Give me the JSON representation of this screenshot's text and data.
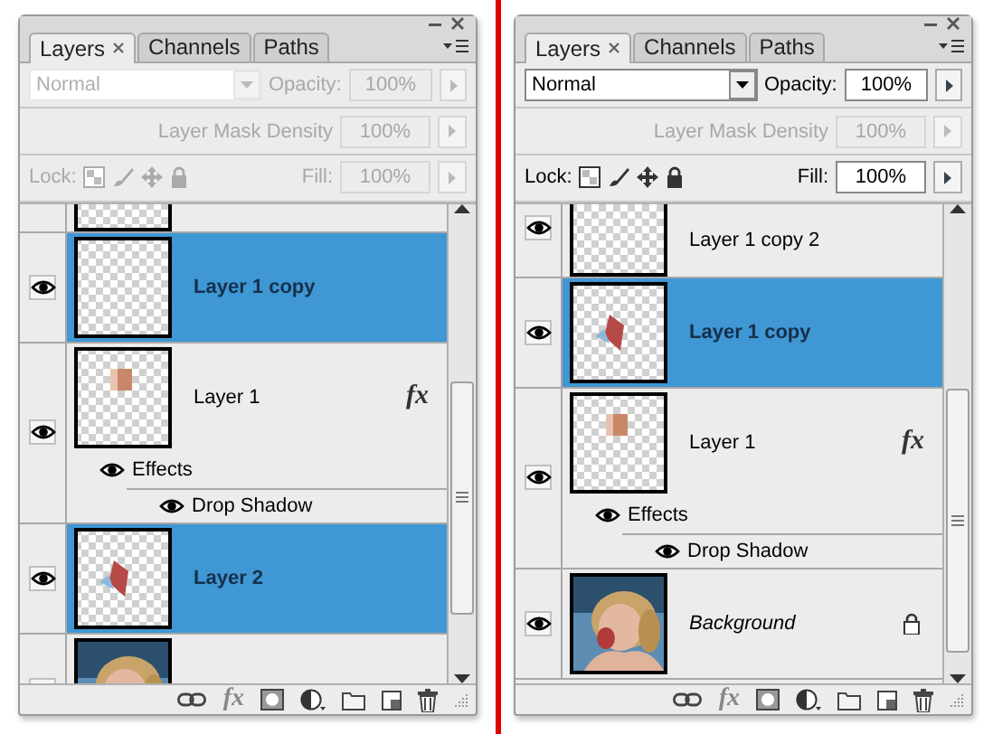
{
  "panels": [
    {
      "tabs": [
        {
          "label": "Layers",
          "selected": true
        },
        {
          "label": "Channels",
          "selected": false
        },
        {
          "label": "Paths",
          "selected": false
        }
      ],
      "blend_mode": {
        "value": "Normal",
        "disabled": true
      },
      "opacity": {
        "label": "Opacity:",
        "value": "100%",
        "disabled": true
      },
      "mask_density": {
        "label": "Layer Mask Density",
        "value": "100%",
        "disabled": true
      },
      "lock_label": {
        "text": "Lock:",
        "disabled": true
      },
      "fill": {
        "label": "Fill:",
        "value": "100%",
        "disabled": true
      },
      "layers": [
        {
          "kind": "cut_top",
          "thumbnail": {
            "kind": "empty"
          }
        },
        {
          "kind": "layer",
          "name": "Layer 1 copy",
          "visible": true,
          "selected": true,
          "thumbnail": {
            "kind": "empty"
          }
        },
        {
          "kind": "layer",
          "name": "Layer 1",
          "visible": true,
          "selected": false,
          "thumbnail": {
            "kind": "patch"
          },
          "fx": "fx",
          "effects": [
            {
              "name": "Effects",
              "visible": true,
              "children": [
                {
                  "name": "Drop Shadow",
                  "visible": true
                }
              ]
            }
          ]
        },
        {
          "kind": "layer",
          "name": "Layer 2",
          "visible": true,
          "selected": true,
          "thumbnail": {
            "kind": "shard"
          }
        },
        {
          "kind": "cut_bottom"
        }
      ],
      "footer_fx": "fx"
    },
    {
      "tabs": [
        {
          "label": "Layers",
          "selected": true
        },
        {
          "label": "Channels",
          "selected": false
        },
        {
          "label": "Paths",
          "selected": false
        }
      ],
      "blend_mode": {
        "value": "Normal",
        "disabled": false
      },
      "opacity": {
        "label": "Opacity:",
        "value": "100%",
        "disabled": false
      },
      "mask_density": {
        "label": "Layer Mask Density",
        "value": "100%",
        "disabled": true
      },
      "lock_label": {
        "text": "Lock:",
        "disabled": false
      },
      "fill": {
        "label": "Fill:",
        "value": "100%",
        "disabled": false
      },
      "layers": [
        {
          "kind": "cut_top",
          "name": "Layer 1 copy 2",
          "visible": true,
          "selected": false,
          "thumbnail": {
            "kind": "empty"
          }
        },
        {
          "kind": "layer",
          "name": "Layer 1 copy",
          "visible": true,
          "selected": true,
          "thumbnail": {
            "kind": "shard"
          }
        },
        {
          "kind": "layer",
          "name": "Layer 1",
          "visible": true,
          "selected": false,
          "thumbnail": {
            "kind": "patch"
          },
          "fx": "fx",
          "effects": [
            {
              "name": "Effects",
              "visible": true,
              "children": [
                {
                  "name": "Drop Shadow",
                  "visible": true
                }
              ]
            }
          ]
        },
        {
          "kind": "background",
          "name": "Background",
          "visible": true,
          "selected": false,
          "locked": true
        }
      ],
      "footer_fx": "fx"
    }
  ]
}
